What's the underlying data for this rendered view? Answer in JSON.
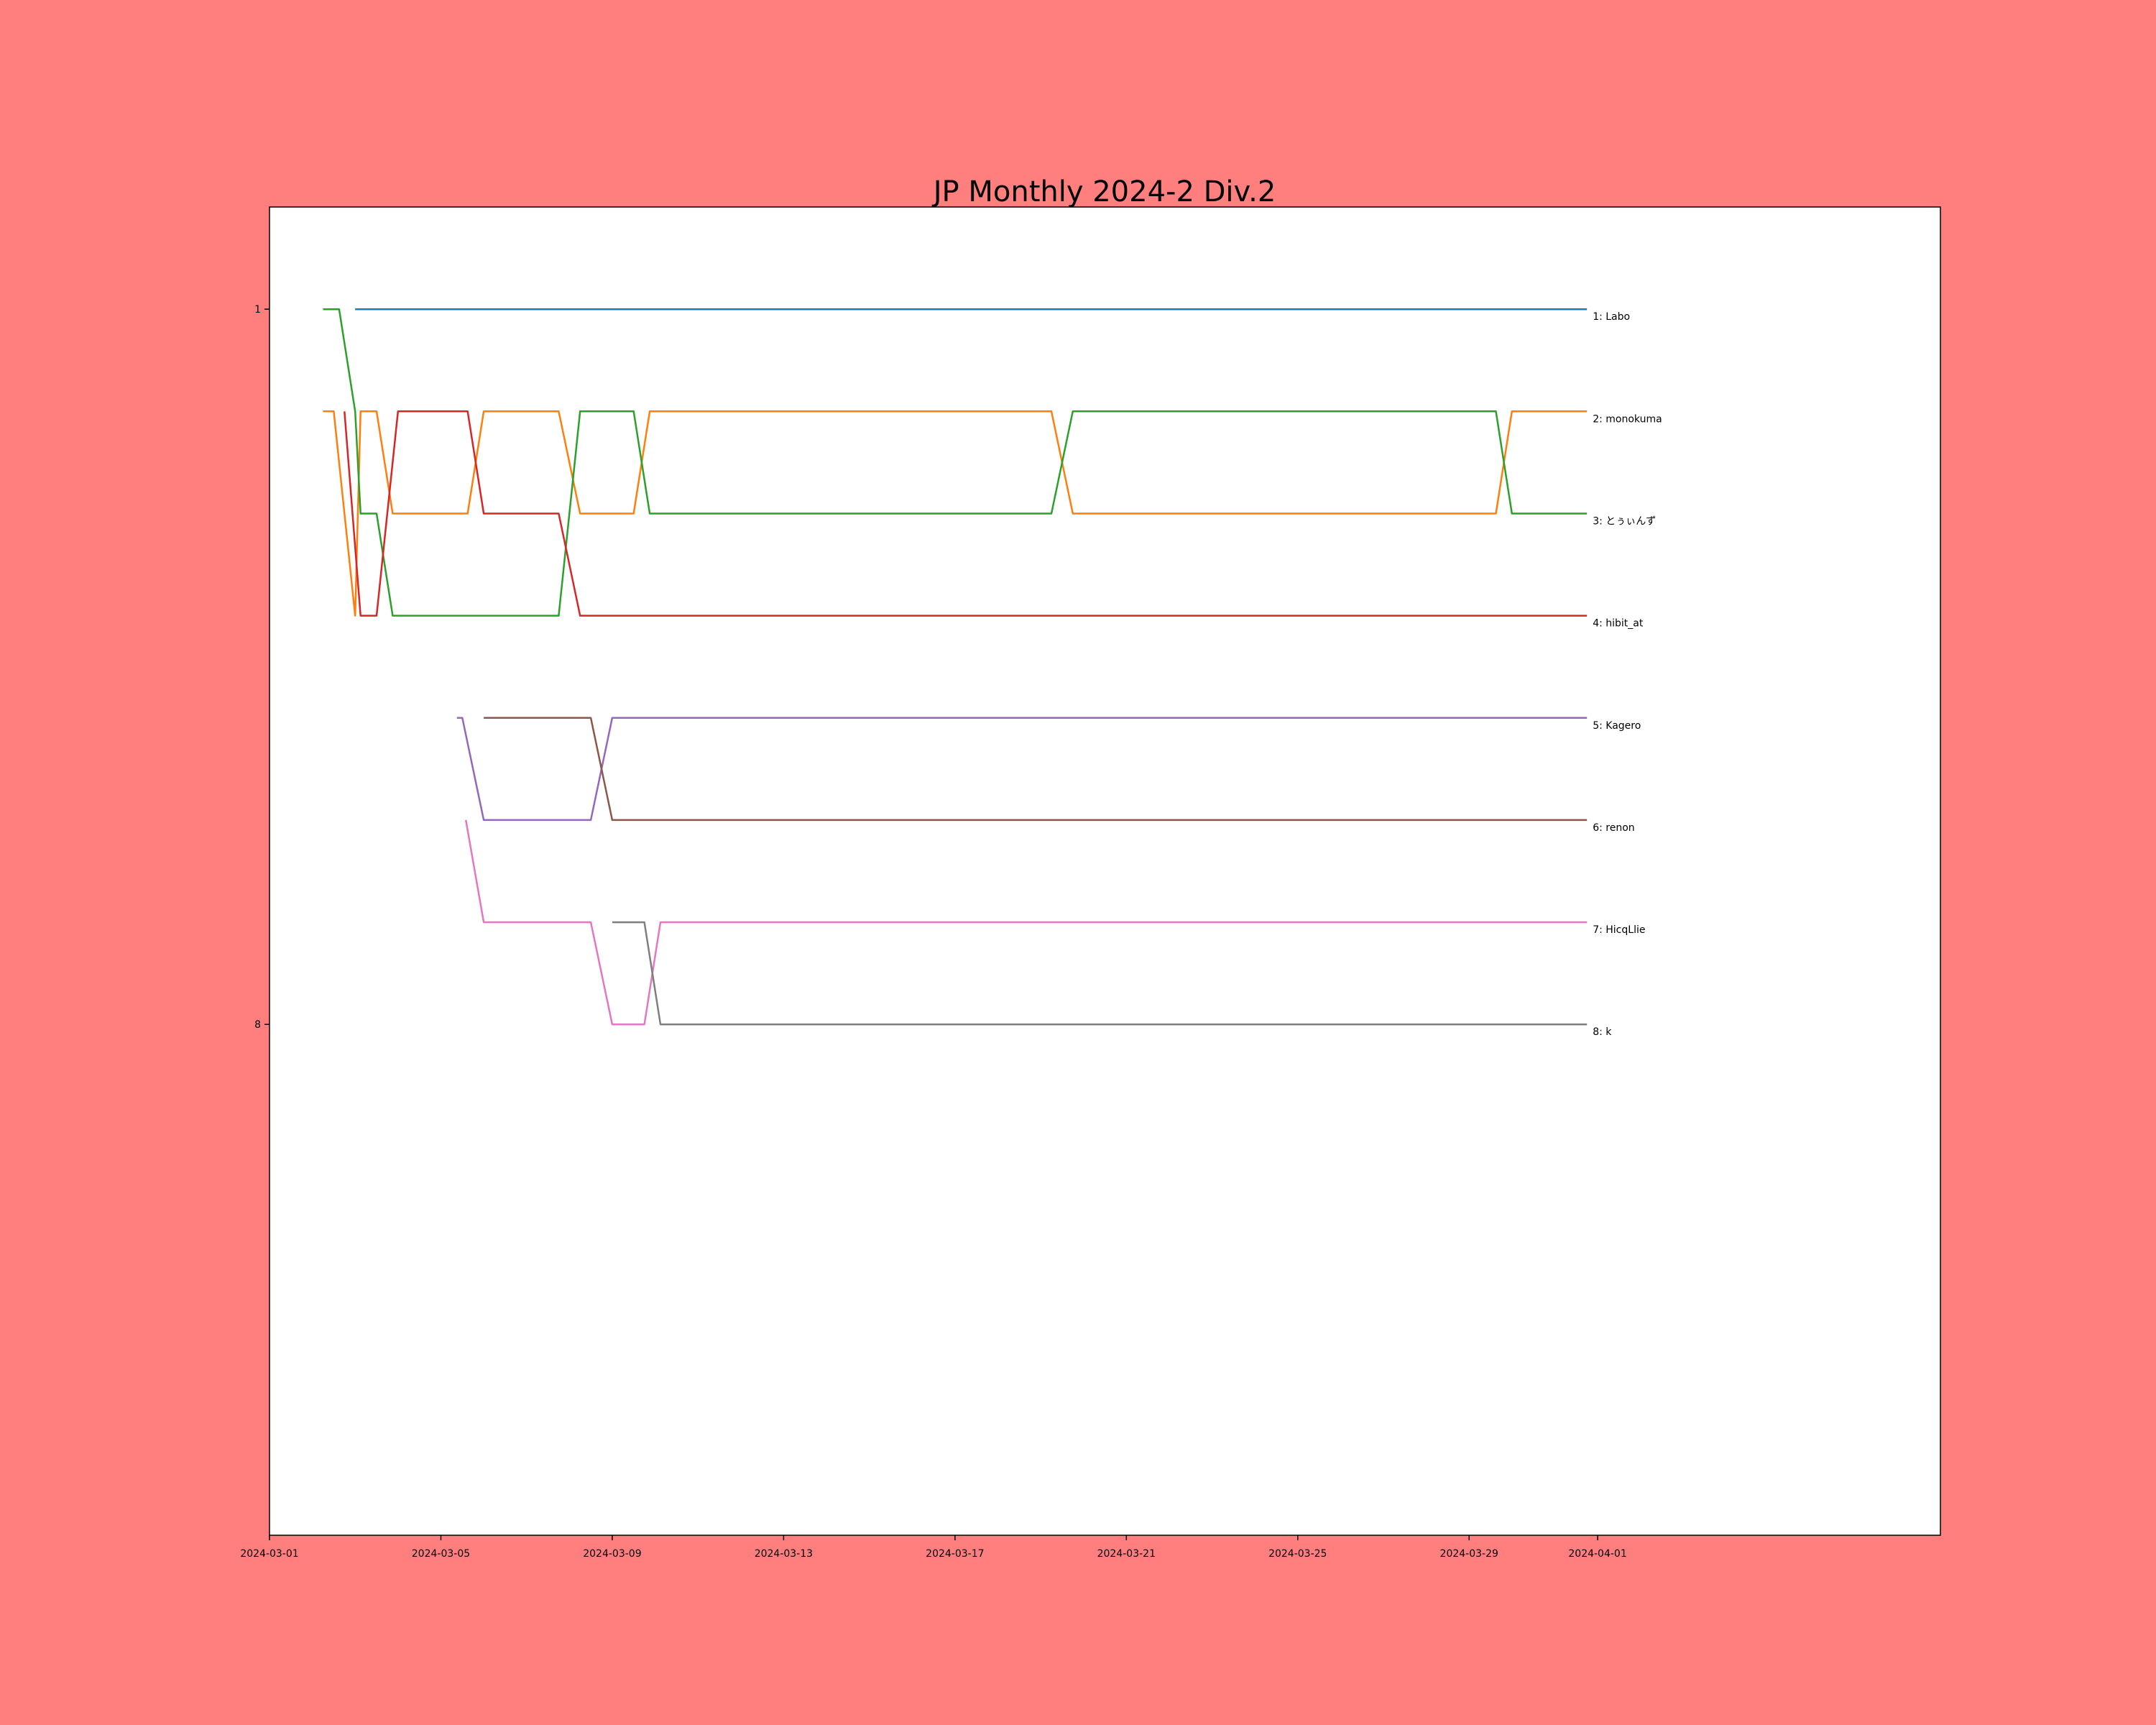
{
  "chart_data": {
    "type": "line",
    "title": "JP Monthly 2024-2 Div.2",
    "xlabel": "",
    "ylabel": "",
    "x_axis": {
      "type": "date",
      "range": [
        "2024-03-01",
        "2024-04-09"
      ],
      "ticks": [
        "2024-03-01",
        "2024-03-05",
        "2024-03-09",
        "2024-03-13",
        "2024-03-17",
        "2024-03-21",
        "2024-03-25",
        "2024-03-29",
        "2024-04-01"
      ]
    },
    "y_axis": {
      "inverted": true,
      "range": [
        0,
        13
      ],
      "ticks": [
        1,
        8
      ]
    },
    "grid": false,
    "colors": {
      "background": "#ff7f7f",
      "plot_background": "#ffffff"
    },
    "series": [
      {
        "label": "1: Labo",
        "color": "#1f77b4",
        "segments": [
          [
            [
              "2024-03-03T00:00",
              1
            ],
            [
              "2024-03-31T18:00",
              1
            ]
          ]
        ]
      },
      {
        "label": "2: monokuma",
        "color": "#ff7f0e",
        "segments": [
          [
            [
              "2024-03-02T06:00",
              2
            ],
            [
              "2024-03-02T12:00",
              2
            ],
            [
              "2024-03-02T18:00",
              3
            ],
            [
              "2024-03-03T00:00",
              4
            ],
            [
              "2024-03-03T03:00",
              2
            ],
            [
              "2024-03-03T12:00",
              2
            ],
            [
              "2024-03-03T21:00",
              3
            ],
            [
              "2024-03-05T15:00",
              3
            ],
            [
              "2024-03-06T00:00",
              2
            ],
            [
              "2024-03-07T18:00",
              2
            ],
            [
              "2024-03-08T06:00",
              3
            ],
            [
              "2024-03-09T12:00",
              3
            ],
            [
              "2024-03-09T21:00",
              2
            ],
            [
              "2024-03-19T06:00",
              2
            ],
            [
              "2024-03-19T18:00",
              3
            ],
            [
              "2024-03-29T15:00",
              3
            ],
            [
              "2024-03-30T00:00",
              2
            ],
            [
              "2024-03-31T18:00",
              2
            ]
          ]
        ]
      },
      {
        "label": "3: とぅぃんず",
        "color": "#2ca02c",
        "segments": [
          [
            [
              "2024-03-02T06:00",
              1
            ],
            [
              "2024-03-02T15:00",
              1
            ],
            [
              "2024-03-03T00:00",
              2
            ],
            [
              "2024-03-03T03:00",
              3
            ],
            [
              "2024-03-03T12:00",
              3
            ],
            [
              "2024-03-03T21:00",
              4
            ],
            [
              "2024-03-07T18:00",
              4
            ],
            [
              "2024-03-08T06:00",
              2
            ],
            [
              "2024-03-09T12:00",
              2
            ],
            [
              "2024-03-09T21:00",
              3
            ],
            [
              "2024-03-19T06:00",
              3
            ],
            [
              "2024-03-19T18:00",
              2
            ],
            [
              "2024-03-29T15:00",
              2
            ],
            [
              "2024-03-30T00:00",
              3
            ],
            [
              "2024-03-31T18:00",
              3
            ]
          ]
        ]
      },
      {
        "label": "4: hibit_at",
        "color": "#d62728",
        "segments": [
          [
            [
              "2024-03-02T18:00",
              2
            ],
            [
              "2024-03-03T03:00",
              4
            ],
            [
              "2024-03-03T12:00",
              4
            ],
            [
              "2024-03-04T00:00",
              2
            ],
            [
              "2024-03-05T15:00",
              2
            ],
            [
              "2024-03-06T00:00",
              3
            ],
            [
              "2024-03-07T18:00",
              3
            ],
            [
              "2024-03-08T06:00",
              4
            ],
            [
              "2024-03-31T18:00",
              4
            ]
          ]
        ]
      },
      {
        "label": "5: Kagero",
        "color": "#9467bd",
        "segments": [
          [
            [
              "2024-03-05T09:00",
              5
            ],
            [
              "2024-03-05T12:00",
              5
            ],
            [
              "2024-03-06T00:00",
              6
            ],
            [
              "2024-03-08T12:00",
              6
            ],
            [
              "2024-03-09T00:00",
              5
            ],
            [
              "2024-03-31T18:00",
              5
            ]
          ]
        ]
      },
      {
        "label": "6: renon",
        "color": "#8c564b",
        "segments": [
          [
            [
              "2024-03-06T00:00",
              5
            ],
            [
              "2024-03-08T12:00",
              5
            ],
            [
              "2024-03-09T00:00",
              6
            ],
            [
              "2024-03-31T18:00",
              6
            ]
          ]
        ]
      },
      {
        "label": "7: HicqLlie",
        "color": "#e377c2",
        "segments": [
          [
            [
              "2024-03-05T14:00",
              6
            ],
            [
              "2024-03-06T00:00",
              7
            ],
            [
              "2024-03-08T12:00",
              7
            ],
            [
              "2024-03-09T00:00",
              8
            ],
            [
              "2024-03-09T18:00",
              8
            ],
            [
              "2024-03-10T03:00",
              7
            ],
            [
              "2024-03-31T18:00",
              7
            ]
          ]
        ]
      },
      {
        "label": "8: k",
        "color": "#7f7f7f",
        "segments": [
          [
            [
              "2024-03-09T00:00",
              7
            ],
            [
              "2024-03-09T18:00",
              7
            ],
            [
              "2024-03-10T03:00",
              8
            ],
            [
              "2024-03-31T18:00",
              8
            ]
          ]
        ]
      }
    ]
  }
}
